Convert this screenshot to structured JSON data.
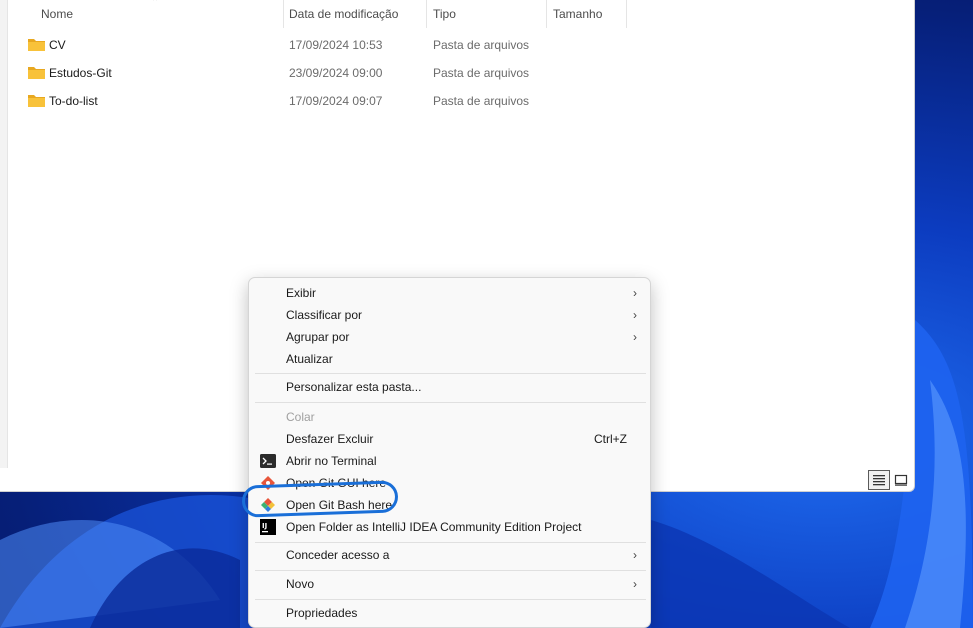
{
  "columns": {
    "name": "Nome",
    "modified": "Data de modificação",
    "type": "Tipo",
    "size": "Tamanho"
  },
  "files": [
    {
      "name": "CV",
      "date": "17/09/2024 10:53",
      "type": "Pasta de arquivos",
      "icon": "folder-icon"
    },
    {
      "name": "Estudos-Git",
      "date": "23/09/2024 09:00",
      "type": "Pasta de arquivos",
      "icon": "folder-icon"
    },
    {
      "name": "To-do-list",
      "date": "17/09/2024 09:07",
      "type": "Pasta de arquivos",
      "icon": "folder-icon"
    }
  ],
  "context_menu": {
    "exibir": "Exibir",
    "classificar": "Classificar por",
    "agrupar": "Agrupar por",
    "atualizar": "Atualizar",
    "personalizar": "Personalizar esta pasta...",
    "colar": "Colar",
    "desfazer": "Desfazer Excluir",
    "desfazer_shortcut": "Ctrl+Z",
    "terminal": "Abrir no Terminal",
    "git_gui": "Open Git GUI here",
    "git_bash": "Open Git Bash here",
    "intellij": "Open Folder as IntelliJ IDEA Community Edition Project",
    "intellij_badge": "IJ",
    "conceder": "Conceder acesso a",
    "novo": "Novo",
    "propriedades": "Propriedades"
  },
  "colors": {
    "folder": "#f8c23a",
    "highlight_circle": "#1a6fd8",
    "wallpaper": "#0c3cc0"
  }
}
